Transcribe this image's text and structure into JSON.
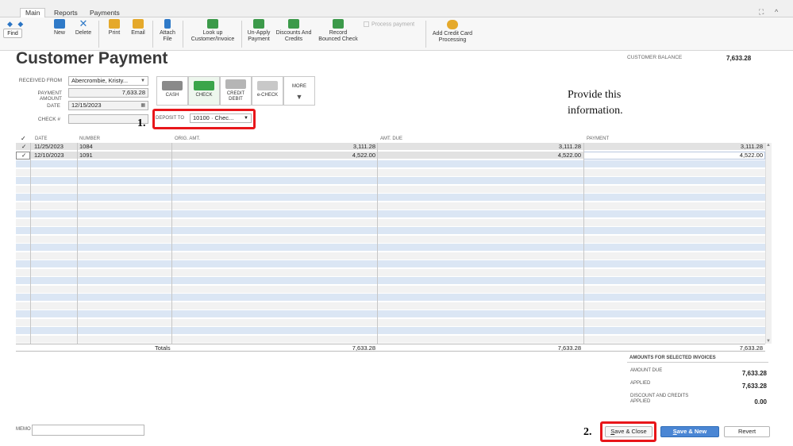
{
  "tabs": [
    "Main",
    "Reports",
    "Payments"
  ],
  "window_controls": {
    "maximize": "⛶",
    "collapse": "^"
  },
  "ribbon": {
    "find": "Find",
    "new": "New",
    "delete": "Delete",
    "print": "Print",
    "email": "Email",
    "attach_1": "Attach",
    "attach_2": "File",
    "lookup_1": "Look up",
    "lookup_2": "Customer/Invoice",
    "unapply_1": "Un-Apply",
    "unapply_2": "Payment",
    "discounts_1": "Discounts And",
    "discounts_2": "Credits",
    "record_1": "Record",
    "record_2": "Bounced Check",
    "process_payment": "Process payment",
    "addcc_1": "Add Credit Card",
    "addcc_2": "Processing"
  },
  "header": {
    "title": "Customer Payment",
    "customer_balance_label": "CUSTOMER BALANCE",
    "customer_balance": "7,633.28"
  },
  "form": {
    "received_from_label": "RECEIVED FROM",
    "received_from": "Abercrombie, Kristy...",
    "payment_amount_label": "PAYMENT AMOUNT",
    "payment_amount": "7,633.28",
    "date_label": "DATE",
    "date": "12/15/2023",
    "check_label": "CHECK #",
    "check": "",
    "deposit_to_label": "DEPOSIT TO",
    "deposit_to": "10100 · Chec..."
  },
  "payment_methods": {
    "cash": "CASH",
    "check": "CHECK",
    "credit_1": "CREDIT",
    "credit_2": "DEBIT",
    "echeck": "e-CHECK",
    "more": "MORE"
  },
  "annotations": {
    "one": "1.",
    "two": "2.",
    "note_1": "Provide this",
    "note_2": "information."
  },
  "table": {
    "headers": [
      "✓",
      "DATE",
      "NUMBER",
      "ORIG. AMT.",
      "AMT. DUE",
      "PAYMENT"
    ],
    "rows": [
      {
        "check": "✓",
        "date": "11/25/2023",
        "number": "1084",
        "orig": "3,111.28",
        "due": "3,111.28",
        "payment": "3,111.28"
      },
      {
        "check": "✓",
        "date": "12/10/2023",
        "number": "1091",
        "orig": "4,522.00",
        "due": "4,522.00",
        "payment": "4,522.00"
      }
    ],
    "totals_label": "Totals",
    "total_orig": "7,633.28",
    "total_due": "7,633.28",
    "total_payment": "7,633.28"
  },
  "summary": {
    "title": "AMOUNTS FOR SELECTED INVOICES",
    "amount_due_label": "AMOUNT DUE",
    "amount_due": "7,633.28",
    "applied_label": "APPLIED",
    "applied": "7,633.28",
    "discount_label_1": "DISCOUNT AND CREDITS",
    "discount_label_2": "APPLIED",
    "discount": "0.00"
  },
  "bottom": {
    "memo_label": "MEMO",
    "save_close_u": "S",
    "save_close_rest": "ave & Close",
    "save_new_u": "S",
    "save_new_rest": "ave & New",
    "revert": "Revert"
  }
}
